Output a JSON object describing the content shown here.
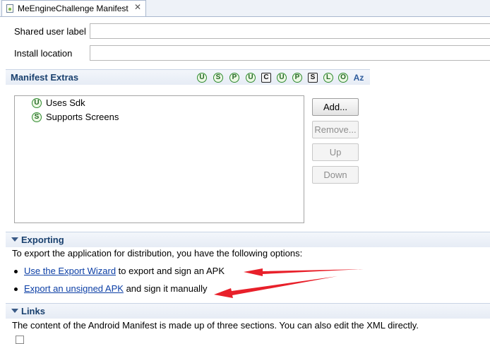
{
  "editor_tab": {
    "title": "MeEngineChallenge Manifest",
    "close_glyph": "✕"
  },
  "fields": {
    "shared_user_label": {
      "label": "Shared user label",
      "value": ""
    },
    "install_location": {
      "label": "Install location",
      "value": ""
    }
  },
  "manifest_extras": {
    "title": "Manifest Extras",
    "tools": [
      "U",
      "S",
      "P",
      "U",
      "C",
      "U",
      "P",
      "S",
      "L",
      "O",
      "Az"
    ],
    "items": [
      {
        "icon": "S",
        "label": "Uses Sdk",
        "icon_letter": "U"
      },
      {
        "icon": "S",
        "label": "Supports Screens",
        "icon_letter": "S"
      }
    ],
    "buttons": {
      "add": "Add...",
      "remove": "Remove...",
      "up": "Up",
      "down": "Down"
    }
  },
  "exporting": {
    "title": "Exporting",
    "intro": "To export the application for distribution, you have the following options:",
    "option1_link": "Use the Export Wizard",
    "option1_rest": "to export and sign an APK",
    "option2_link": "Export an unsigned APK",
    "option2_rest": "and sign it manually"
  },
  "links": {
    "title": "Links",
    "intro": "The content of the Android Manifest is made up of three sections. You can also edit the XML directly."
  },
  "colors": {
    "section_title": "#19406e",
    "link": "#0b3ea5",
    "annotation_arrow": "#e8202a",
    "tool_icon": "#2f8a2f"
  }
}
